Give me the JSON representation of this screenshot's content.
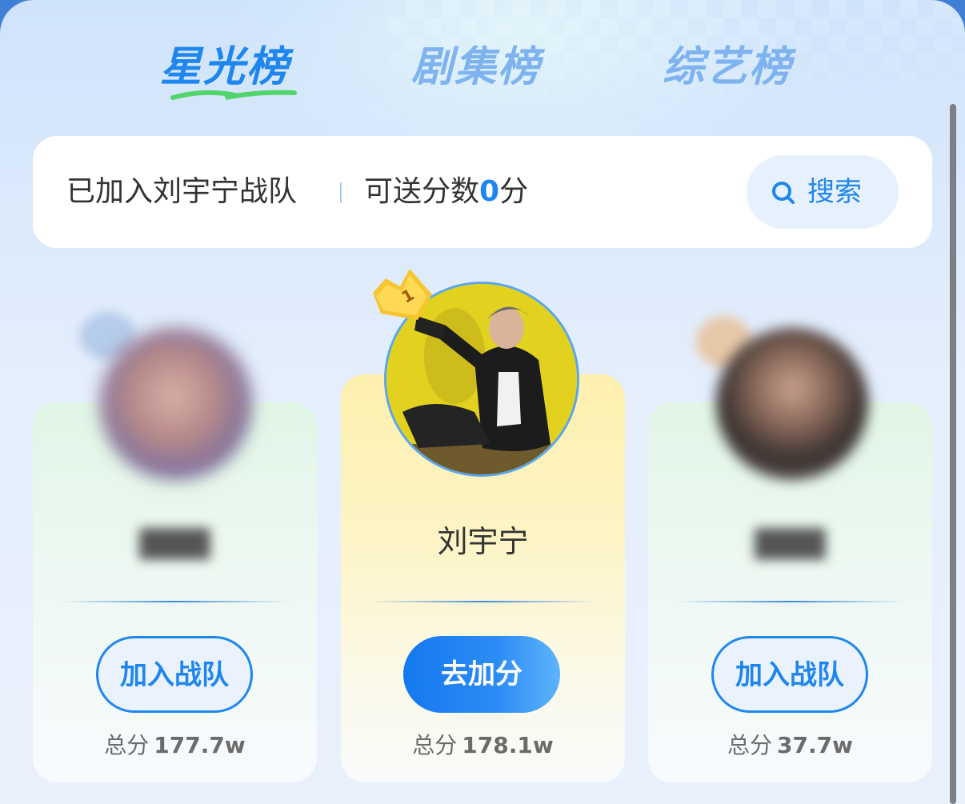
{
  "tabs": [
    {
      "label": "星光榜",
      "active": true
    },
    {
      "label": "剧集榜",
      "active": false
    },
    {
      "label": "综艺榜",
      "active": false
    }
  ],
  "info_bar": {
    "team_text": "已加入刘宇宁战队",
    "points_prefix": "可送分数",
    "points_value": "0",
    "points_suffix": "分",
    "search_label": "搜索",
    "search_icon": "search-icon"
  },
  "ranking": [
    {
      "position": "left",
      "name": "",
      "button_label": "加入战队",
      "score_label": "总分",
      "score_value": "177.7w"
    },
    {
      "position": "center",
      "rank": "1",
      "name": "刘宇宁",
      "button_label": "去加分",
      "score_label": "总分",
      "score_value": "178.1w"
    },
    {
      "position": "right",
      "name": "",
      "button_label": "加入战队",
      "score_label": "总分",
      "score_value": "37.7w"
    }
  ],
  "colors": {
    "accent": "#1e86ee",
    "tab_inactive": "#7fb3ef",
    "gold": "#f7c531"
  }
}
